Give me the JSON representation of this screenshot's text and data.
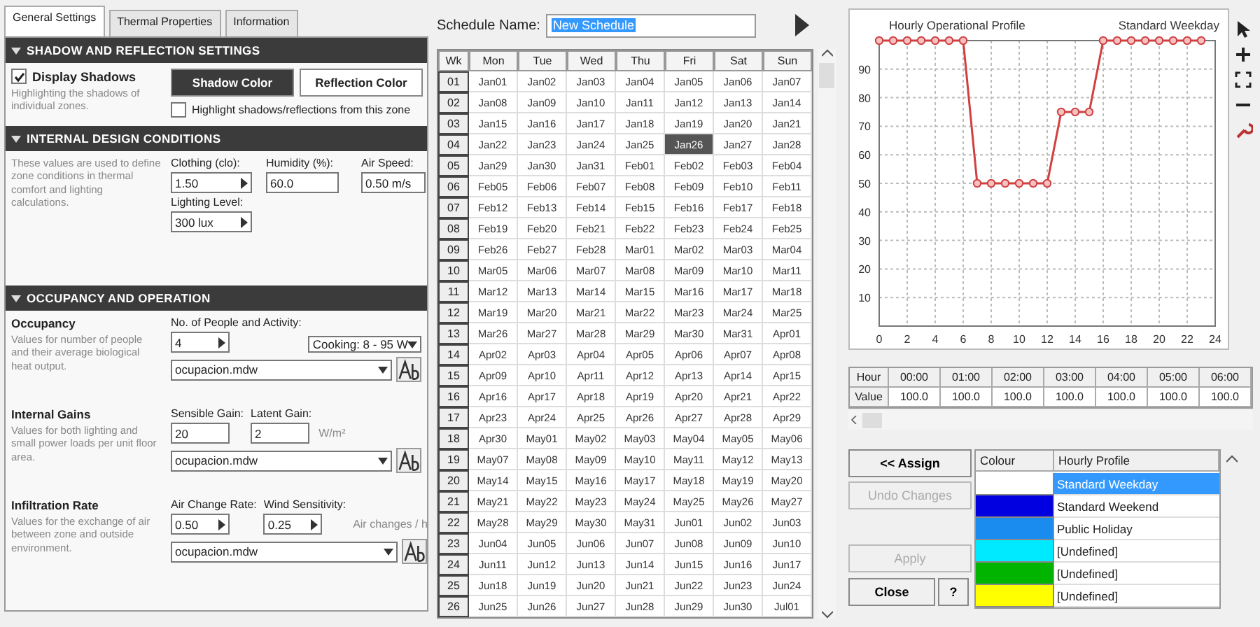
{
  "tabs": [
    {
      "label": "General Settings",
      "selected": true
    },
    {
      "label": "Thermal Properties",
      "selected": false
    },
    {
      "label": "Information",
      "selected": false
    }
  ],
  "sections": [
    {
      "kind": "shadow",
      "title": "SHADOW AND REFLECTION SETTINGS",
      "expanded": true,
      "checkbox": {
        "label": "Display Shadows",
        "checked": true
      },
      "description": "Highlighting the shadows of individual zones.",
      "buttons": [
        {
          "label": "Shadow Color",
          "kind": "dark"
        },
        {
          "label": "Reflection Color",
          "kind": "light"
        }
      ],
      "option": {
        "label": "Highlight shadows/reflections from this zone",
        "checked": false
      }
    },
    {
      "kind": "conditions",
      "title": "INTERNAL DESIGN CONDITIONS",
      "expanded": true,
      "description": "These values are used to define zone conditions in thermal comfort and lighting calculations.",
      "fields": [
        {
          "label": "Clothing (clo):",
          "value": "1.50",
          "spin": true
        },
        {
          "label": "Humidity (%):",
          "value": "60.0",
          "spin": false
        },
        {
          "label": "Air Speed:",
          "value": "0.50 m/s",
          "spin": false
        },
        {
          "label": "Lighting Level:",
          "value": "300 lux",
          "spin": true
        }
      ]
    },
    {
      "kind": "groups",
      "title": "OCCUPANCY AND OPERATION",
      "expanded": true,
      "groups": [
        {
          "title": "Occupancy",
          "description": "Values for number of people and their average biological heat output.",
          "fields": [
            {
              "kind": "input",
              "label": "No. of People and Activity:",
              "value": "4",
              "spin": true
            },
            {
              "kind": "dropdown",
              "value": "Cooking: 8 - 95 W"
            }
          ],
          "schedule": "ocupacion.mdw"
        },
        {
          "title": "Internal Gains",
          "description": "Values for both lighting and small power loads per unit floor area.",
          "fields": [
            {
              "kind": "input",
              "label": "Sensible Gain:",
              "value": "20",
              "spin": false
            },
            {
              "kind": "input",
              "label": "Latent Gain:",
              "value": "2",
              "spin": false
            }
          ],
          "unit": "W/m²",
          "schedule": "ocupacion.mdw"
        },
        {
          "title": "Infiltration Rate",
          "description": "Values for the exchange of air between zone and outside environment.",
          "fields": [
            {
              "kind": "input",
              "label": "Air Change Rate:",
              "value": "0.50",
              "spin": true
            },
            {
              "kind": "input",
              "label": "Wind Sensitivity:",
              "value": "0.25",
              "spin": true
            }
          ],
          "unit": "Air changes / h",
          "schedule": "ocupacion.mdw"
        }
      ]
    }
  ],
  "schedule": {
    "label": "Schedule Name:",
    "name": "New Schedule",
    "columns": [
      "Wk",
      "Mon",
      "Tue",
      "Wed",
      "Thu",
      "Fri",
      "Sat",
      "Sun"
    ],
    "weeks": [
      {
        "week": "01",
        "days": [
          {
            "date": "Jan01",
            "selected": false
          },
          {
            "date": "Jan02",
            "selected": false
          },
          {
            "date": "Jan03",
            "selected": false
          },
          {
            "date": "Jan04",
            "selected": false
          },
          {
            "date": "Jan05",
            "selected": false
          },
          {
            "date": "Jan06",
            "selected": false
          },
          {
            "date": "Jan07",
            "selected": false
          }
        ]
      },
      {
        "week": "02",
        "days": [
          {
            "date": "Jan08",
            "selected": false
          },
          {
            "date": "Jan09",
            "selected": false
          },
          {
            "date": "Jan10",
            "selected": false
          },
          {
            "date": "Jan11",
            "selected": false
          },
          {
            "date": "Jan12",
            "selected": false
          },
          {
            "date": "Jan13",
            "selected": false
          },
          {
            "date": "Jan14",
            "selected": false
          }
        ]
      },
      {
        "week": "03",
        "days": [
          {
            "date": "Jan15",
            "selected": false
          },
          {
            "date": "Jan16",
            "selected": false
          },
          {
            "date": "Jan17",
            "selected": false
          },
          {
            "date": "Jan18",
            "selected": false
          },
          {
            "date": "Jan19",
            "selected": false
          },
          {
            "date": "Jan20",
            "selected": false
          },
          {
            "date": "Jan21",
            "selected": false
          }
        ]
      },
      {
        "week": "04",
        "days": [
          {
            "date": "Jan22",
            "selected": false
          },
          {
            "date": "Jan23",
            "selected": false
          },
          {
            "date": "Jan24",
            "selected": false
          },
          {
            "date": "Jan25",
            "selected": false
          },
          {
            "date": "Jan26",
            "selected": true
          },
          {
            "date": "Jan27",
            "selected": false
          },
          {
            "date": "Jan28",
            "selected": false
          }
        ]
      },
      {
        "week": "05",
        "days": [
          {
            "date": "Jan29",
            "selected": false
          },
          {
            "date": "Jan30",
            "selected": false
          },
          {
            "date": "Jan31",
            "selected": false
          },
          {
            "date": "Feb01",
            "selected": false
          },
          {
            "date": "Feb02",
            "selected": false
          },
          {
            "date": "Feb03",
            "selected": false
          },
          {
            "date": "Feb04",
            "selected": false
          }
        ]
      },
      {
        "week": "06",
        "days": [
          {
            "date": "Feb05",
            "selected": false
          },
          {
            "date": "Feb06",
            "selected": false
          },
          {
            "date": "Feb07",
            "selected": false
          },
          {
            "date": "Feb08",
            "selected": false
          },
          {
            "date": "Feb09",
            "selected": false
          },
          {
            "date": "Feb10",
            "selected": false
          },
          {
            "date": "Feb11",
            "selected": false
          }
        ]
      },
      {
        "week": "07",
        "days": [
          {
            "date": "Feb12",
            "selected": false
          },
          {
            "date": "Feb13",
            "selected": false
          },
          {
            "date": "Feb14",
            "selected": false
          },
          {
            "date": "Feb15",
            "selected": false
          },
          {
            "date": "Feb16",
            "selected": false
          },
          {
            "date": "Feb17",
            "selected": false
          },
          {
            "date": "Feb18",
            "selected": false
          }
        ]
      },
      {
        "week": "08",
        "days": [
          {
            "date": "Feb19",
            "selected": false
          },
          {
            "date": "Feb20",
            "selected": false
          },
          {
            "date": "Feb21",
            "selected": false
          },
          {
            "date": "Feb22",
            "selected": false
          },
          {
            "date": "Feb23",
            "selected": false
          },
          {
            "date": "Feb24",
            "selected": false
          },
          {
            "date": "Feb25",
            "selected": false
          }
        ]
      },
      {
        "week": "09",
        "days": [
          {
            "date": "Feb26",
            "selected": false
          },
          {
            "date": "Feb27",
            "selected": false
          },
          {
            "date": "Feb28",
            "selected": false
          },
          {
            "date": "Mar01",
            "selected": false
          },
          {
            "date": "Mar02",
            "selected": false
          },
          {
            "date": "Mar03",
            "selected": false
          },
          {
            "date": "Mar04",
            "selected": false
          }
        ]
      },
      {
        "week": "10",
        "days": [
          {
            "date": "Mar05",
            "selected": false
          },
          {
            "date": "Mar06",
            "selected": false
          },
          {
            "date": "Mar07",
            "selected": false
          },
          {
            "date": "Mar08",
            "selected": false
          },
          {
            "date": "Mar09",
            "selected": false
          },
          {
            "date": "Mar10",
            "selected": false
          },
          {
            "date": "Mar11",
            "selected": false
          }
        ]
      },
      {
        "week": "11",
        "days": [
          {
            "date": "Mar12",
            "selected": false
          },
          {
            "date": "Mar13",
            "selected": false
          },
          {
            "date": "Mar14",
            "selected": false
          },
          {
            "date": "Mar15",
            "selected": false
          },
          {
            "date": "Mar16",
            "selected": false
          },
          {
            "date": "Mar17",
            "selected": false
          },
          {
            "date": "Mar18",
            "selected": false
          }
        ]
      },
      {
        "week": "12",
        "days": [
          {
            "date": "Mar19",
            "selected": false
          },
          {
            "date": "Mar20",
            "selected": false
          },
          {
            "date": "Mar21",
            "selected": false
          },
          {
            "date": "Mar22",
            "selected": false
          },
          {
            "date": "Mar23",
            "selected": false
          },
          {
            "date": "Mar24",
            "selected": false
          },
          {
            "date": "Mar25",
            "selected": false
          }
        ]
      },
      {
        "week": "13",
        "days": [
          {
            "date": "Mar26",
            "selected": false
          },
          {
            "date": "Mar27",
            "selected": false
          },
          {
            "date": "Mar28",
            "selected": false
          },
          {
            "date": "Mar29",
            "selected": false
          },
          {
            "date": "Mar30",
            "selected": false
          },
          {
            "date": "Mar31",
            "selected": false
          },
          {
            "date": "Apr01",
            "selected": false
          }
        ]
      },
      {
        "week": "14",
        "days": [
          {
            "date": "Apr02",
            "selected": false
          },
          {
            "date": "Apr03",
            "selected": false
          },
          {
            "date": "Apr04",
            "selected": false
          },
          {
            "date": "Apr05",
            "selected": false
          },
          {
            "date": "Apr06",
            "selected": false
          },
          {
            "date": "Apr07",
            "selected": false
          },
          {
            "date": "Apr08",
            "selected": false
          }
        ]
      },
      {
        "week": "15",
        "days": [
          {
            "date": "Apr09",
            "selected": false
          },
          {
            "date": "Apr10",
            "selected": false
          },
          {
            "date": "Apr11",
            "selected": false
          },
          {
            "date": "Apr12",
            "selected": false
          },
          {
            "date": "Apr13",
            "selected": false
          },
          {
            "date": "Apr14",
            "selected": false
          },
          {
            "date": "Apr15",
            "selected": false
          }
        ]
      },
      {
        "week": "16",
        "days": [
          {
            "date": "Apr16",
            "selected": false
          },
          {
            "date": "Apr17",
            "selected": false
          },
          {
            "date": "Apr18",
            "selected": false
          },
          {
            "date": "Apr19",
            "selected": false
          },
          {
            "date": "Apr20",
            "selected": false
          },
          {
            "date": "Apr21",
            "selected": false
          },
          {
            "date": "Apr22",
            "selected": false
          }
        ]
      },
      {
        "week": "17",
        "days": [
          {
            "date": "Apr23",
            "selected": false
          },
          {
            "date": "Apr24",
            "selected": false
          },
          {
            "date": "Apr25",
            "selected": false
          },
          {
            "date": "Apr26",
            "selected": false
          },
          {
            "date": "Apr27",
            "selected": false
          },
          {
            "date": "Apr28",
            "selected": false
          },
          {
            "date": "Apr29",
            "selected": false
          }
        ]
      },
      {
        "week": "18",
        "days": [
          {
            "date": "Apr30",
            "selected": false
          },
          {
            "date": "May01",
            "selected": false
          },
          {
            "date": "May02",
            "selected": false
          },
          {
            "date": "May03",
            "selected": false
          },
          {
            "date": "May04",
            "selected": false
          },
          {
            "date": "May05",
            "selected": false
          },
          {
            "date": "May06",
            "selected": false
          }
        ]
      },
      {
        "week": "19",
        "days": [
          {
            "date": "May07",
            "selected": false
          },
          {
            "date": "May08",
            "selected": false
          },
          {
            "date": "May09",
            "selected": false
          },
          {
            "date": "May10",
            "selected": false
          },
          {
            "date": "May11",
            "selected": false
          },
          {
            "date": "May12",
            "selected": false
          },
          {
            "date": "May13",
            "selected": false
          }
        ]
      },
      {
        "week": "20",
        "days": [
          {
            "date": "May14",
            "selected": false
          },
          {
            "date": "May15",
            "selected": false
          },
          {
            "date": "May16",
            "selected": false
          },
          {
            "date": "May17",
            "selected": false
          },
          {
            "date": "May18",
            "selected": false
          },
          {
            "date": "May19",
            "selected": false
          },
          {
            "date": "May20",
            "selected": false
          }
        ]
      },
      {
        "week": "21",
        "days": [
          {
            "date": "May21",
            "selected": false
          },
          {
            "date": "May22",
            "selected": false
          },
          {
            "date": "May23",
            "selected": false
          },
          {
            "date": "May24",
            "selected": false
          },
          {
            "date": "May25",
            "selected": false
          },
          {
            "date": "May26",
            "selected": false
          },
          {
            "date": "May27",
            "selected": false
          }
        ]
      },
      {
        "week": "22",
        "days": [
          {
            "date": "May28",
            "selected": false
          },
          {
            "date": "May29",
            "selected": false
          },
          {
            "date": "May30",
            "selected": false
          },
          {
            "date": "May31",
            "selected": false
          },
          {
            "date": "Jun01",
            "selected": false
          },
          {
            "date": "Jun02",
            "selected": false
          },
          {
            "date": "Jun03",
            "selected": false
          }
        ]
      },
      {
        "week": "23",
        "days": [
          {
            "date": "Jun04",
            "selected": false
          },
          {
            "date": "Jun05",
            "selected": false
          },
          {
            "date": "Jun06",
            "selected": false
          },
          {
            "date": "Jun07",
            "selected": false
          },
          {
            "date": "Jun08",
            "selected": false
          },
          {
            "date": "Jun09",
            "selected": false
          },
          {
            "date": "Jun10",
            "selected": false
          }
        ]
      },
      {
        "week": "24",
        "days": [
          {
            "date": "Jun11",
            "selected": false
          },
          {
            "date": "Jun12",
            "selected": false
          },
          {
            "date": "Jun13",
            "selected": false
          },
          {
            "date": "Jun14",
            "selected": false
          },
          {
            "date": "Jun15",
            "selected": false
          },
          {
            "date": "Jun16",
            "selected": false
          },
          {
            "date": "Jun17",
            "selected": false
          }
        ]
      },
      {
        "week": "25",
        "days": [
          {
            "date": "Jun18",
            "selected": false
          },
          {
            "date": "Jun19",
            "selected": false
          },
          {
            "date": "Jun20",
            "selected": false
          },
          {
            "date": "Jun21",
            "selected": false
          },
          {
            "date": "Jun22",
            "selected": false
          },
          {
            "date": "Jun23",
            "selected": false
          },
          {
            "date": "Jun24",
            "selected": false
          }
        ]
      },
      {
        "week": "26",
        "days": [
          {
            "date": "Jun25",
            "selected": false
          },
          {
            "date": "Jun26",
            "selected": false
          },
          {
            "date": "Jun27",
            "selected": false
          },
          {
            "date": "Jun28",
            "selected": false
          },
          {
            "date": "Jun29",
            "selected": false
          },
          {
            "date": "Jun30",
            "selected": false
          },
          {
            "date": "Jul01",
            "selected": false
          }
        ]
      }
    ]
  },
  "profile_chart": {
    "chart_data": {
      "type": "line",
      "title": "Hourly Operational Profile",
      "grid": true,
      "x": [
        0,
        1,
        2,
        3,
        4,
        5,
        6,
        7,
        8,
        9,
        10,
        11,
        12,
        13,
        14,
        15,
        16,
        17,
        18,
        19,
        20,
        21,
        22,
        23
      ],
      "series": [
        {
          "name": "Standard Weekday",
          "color": "#d04040",
          "marker": "circle",
          "values": [
            100,
            100,
            100,
            100,
            100,
            100,
            100,
            50,
            50,
            50,
            50,
            50,
            50,
            75,
            75,
            75,
            100,
            100,
            100,
            100,
            100,
            100,
            100,
            100
          ]
        }
      ],
      "xlim": [
        0,
        24
      ],
      "ylim": [
        0,
        100
      ],
      "xticks": [
        0,
        2,
        4,
        6,
        8,
        10,
        12,
        14,
        16,
        18,
        20,
        22,
        24
      ],
      "yticks": [
        10,
        20,
        30,
        40,
        50,
        60,
        70,
        80,
        90
      ]
    }
  },
  "hourly_table": {
    "row_labels": [
      "Hour",
      "Value"
    ],
    "hours": [
      "00:00",
      "01:00",
      "02:00",
      "03:00",
      "04:00",
      "05:00",
      "06:00"
    ],
    "values": [
      "100.0",
      "100.0",
      "100.0",
      "100.0",
      "100.0",
      "100.0",
      "100.0"
    ]
  },
  "buttons": [
    {
      "label": "<< Assign",
      "disabled": false
    },
    {
      "label": "Undo Changes",
      "disabled": true
    },
    {
      "label": "Apply",
      "disabled": true
    },
    {
      "label": "Close",
      "disabled": false
    },
    {
      "label": "?",
      "disabled": false
    }
  ],
  "profiles": {
    "columns": [
      "Colour",
      "Hourly Profile"
    ],
    "rows": [
      {
        "color": "#ffffff",
        "name": "Standard Weekday",
        "selected": true
      },
      {
        "color": "#0000e0",
        "name": "Standard Weekend",
        "selected": false
      },
      {
        "color": "#1a8cf0",
        "name": "Public Holiday",
        "selected": false
      },
      {
        "color": "#00eaff",
        "name": "[Undefined]",
        "selected": false
      },
      {
        "color": "#00b400",
        "name": "[Undefined]",
        "selected": false
      },
      {
        "color": "#ffff00",
        "name": "[Undefined]",
        "selected": false
      }
    ]
  }
}
